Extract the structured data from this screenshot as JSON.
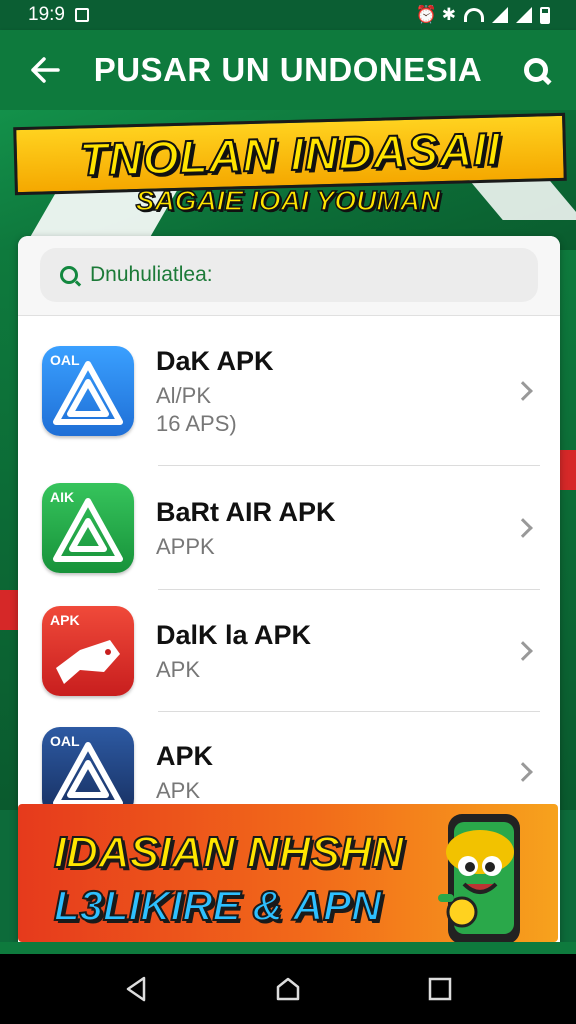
{
  "status_bar": {
    "time": "19:9",
    "right_text": "⏰ ✱"
  },
  "app_bar": {
    "title": "PUSAR UN UNDONESIA",
    "back_icon": "arrow-left-icon",
    "search_icon": "search-icon"
  },
  "hero": {
    "title": "TNOLAN INDASAII",
    "subtitle": "SAGAIE IOAI YOUMAN"
  },
  "search": {
    "placeholder": "Dnuhuliatlea:"
  },
  "apps": [
    {
      "name": "DaK APK",
      "meta": "Al/PK",
      "meta2": "16 APS)",
      "icon_tag": "OAL",
      "icon_color": "#1f7fe0"
    },
    {
      "name": "BaRt AIR APK",
      "meta": "APPK",
      "meta2": "",
      "icon_tag": "AIK",
      "icon_color": "#1fa543"
    },
    {
      "name": "DalK la APK",
      "meta": "APK",
      "meta2": "",
      "icon_tag": "APK",
      "icon_color": "#e03030"
    },
    {
      "name": "APK",
      "meta": "APK",
      "meta2": "",
      "icon_tag": "OAL",
      "icon_color": "#1e3f7a"
    }
  ],
  "promo": {
    "line1": "IDASIAN NHSHN",
    "line2": "L3LIKIRE & APN"
  },
  "colors": {
    "primary_green": "#0e7a3d",
    "accent_yellow": "#ffd21f",
    "promo_orange": "#f26b1a"
  },
  "nav": {
    "back": "triangle-back-icon",
    "home": "circle-home-icon",
    "recents": "square-recents-icon"
  }
}
